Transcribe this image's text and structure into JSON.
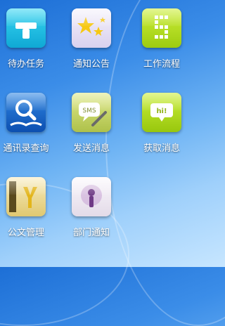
{
  "apps": [
    {
      "label": "待办任务",
      "icon": "task-icon",
      "color": "#1ec3e6"
    },
    {
      "label": "通知公告",
      "icon": "stars-icon",
      "color": "#e8e2f6"
    },
    {
      "label": "工作流程",
      "icon": "workflow-icon",
      "color": "#b7e21c"
    },
    {
      "label": "通讯录查询",
      "icon": "address-book-search-icon",
      "color": "#1a66c9"
    },
    {
      "label": "发送消息",
      "icon": "sms-send-icon",
      "color": "#c9d86a"
    },
    {
      "label": "获取消息",
      "icon": "hi-message-icon",
      "color": "#b5e31a"
    },
    {
      "label": "公文管理",
      "icon": "document-folder-icon",
      "color": "#f0e2a8"
    },
    {
      "label": "部门通知",
      "icon": "microphone-icon",
      "color": "#f1ecf4"
    }
  ]
}
